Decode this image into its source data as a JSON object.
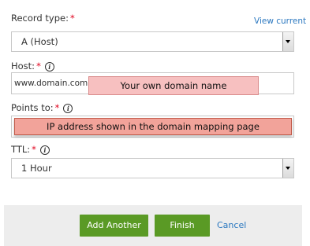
{
  "record_type": {
    "label": "Record type:",
    "required_mark": "*",
    "view_current_link": "View current",
    "value": "A (Host)"
  },
  "host": {
    "label": "Host:",
    "required_mark": "*",
    "info_glyph": "i",
    "value": "www.domain.com",
    "callout": "Your own domain name"
  },
  "points_to": {
    "label": "Points to:",
    "required_mark": "*",
    "info_glyph": "i",
    "value": "",
    "callout": "IP address shown in the domain mapping page"
  },
  "ttl": {
    "label": "TTL:",
    "required_mark": "*",
    "info_glyph": "i",
    "value": "1 Hour"
  },
  "actions": {
    "add_another": "Add Another",
    "finish": "Finish",
    "cancel": "Cancel"
  },
  "colors": {
    "primary_button": "#5a9a25",
    "link": "#2b78c0",
    "required": "#e0001b",
    "callout_fill": "#f7c0c0",
    "footer_bg": "#ededed"
  },
  "icons": {
    "info": "info-icon",
    "dropdown": "chevron-down-icon"
  }
}
